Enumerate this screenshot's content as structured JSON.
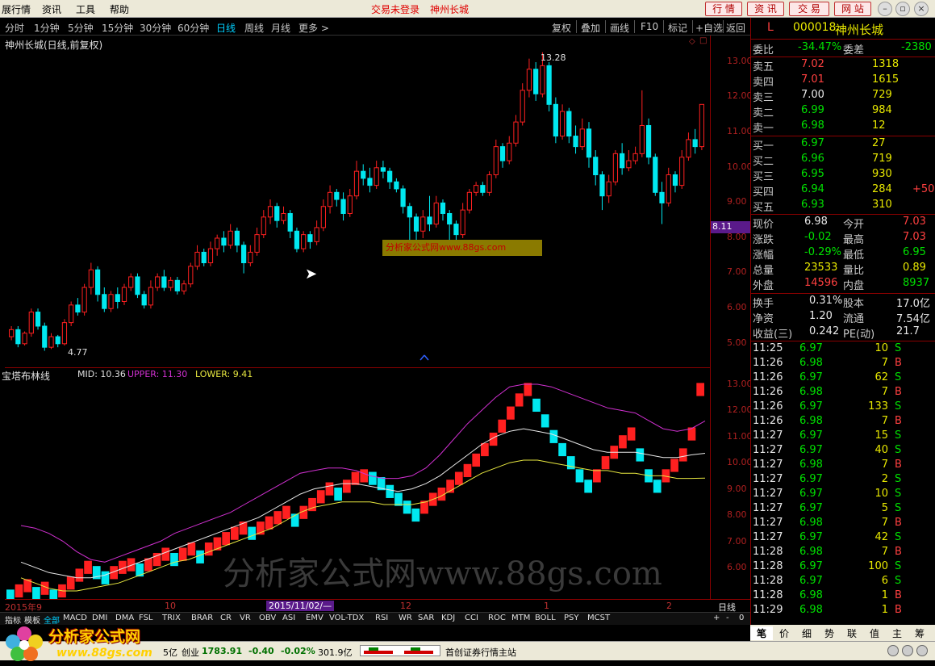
{
  "menu": {
    "items": [
      "展行情",
      "资讯",
      "工具",
      "帮助"
    ],
    "login_status": "交易未登录",
    "stock_title": "神州长城",
    "buttons": [
      "行 情",
      "资 讯",
      "交 易",
      "网 站"
    ]
  },
  "period": {
    "items": [
      "分时",
      "1分钟",
      "5分钟",
      "15分钟",
      "30分钟",
      "60分钟",
      "日线",
      "周线",
      "月线",
      "更多 >"
    ],
    "active": "日线"
  },
  "toolbar": {
    "items": [
      "复权",
      "叠加",
      "画线",
      "F10",
      "标记",
      "+自选",
      "返回"
    ]
  },
  "main_chart": {
    "title": "神州长城(日线,前复权)",
    "max_label": "13.28",
    "min_label": "4.77",
    "watermark": "分析家公式网www.88gs.com",
    "price_tag": "8.11"
  },
  "sub_chart": {
    "title": "宝塔布林线",
    "mid": "MID: 10.36",
    "upper": "UPPER: 11.30",
    "lower": "LOWER: 9.41",
    "watermark": "分析家公式网www.88gs.com"
  },
  "axis1": [
    "13.00",
    "12.00",
    "11.00",
    "10.00",
    "9.00",
    "8.00",
    "7.00",
    "6.00",
    "5.00"
  ],
  "axis2": [
    "13.00",
    "12.00",
    "11.00",
    "10.00",
    "9.00",
    "8.00",
    "7.00",
    "6.00"
  ],
  "dates": {
    "start": "2015年9",
    "m10": "10",
    "cursor": "2015/11/02/—",
    "m12": "12",
    "m1": "1",
    "m2": "2",
    "period": "日线"
  },
  "indicator_tabs": [
    "指标",
    "模板",
    "全部",
    "MACD",
    "DMI",
    "DMA",
    "FSL",
    "TRIX",
    "BRAR",
    "CR",
    "VR",
    "OBV",
    "ASI",
    "EMV",
    "VOL-TDX",
    "RSI",
    "WR",
    "SAR",
    "KDJ",
    "CCI",
    "ROC",
    "MTM",
    "BOLL",
    "PSY",
    "MCST"
  ],
  "quote": {
    "code": "000018",
    "name": "神州长城",
    "flag": "L",
    "weibi_label": "委比",
    "weibi": "-34.47%",
    "weicha_label": "委差",
    "weicha": "-2380",
    "asks": [
      {
        "l": "卖五",
        "p": "7.02",
        "v": "1318"
      },
      {
        "l": "卖四",
        "p": "7.01",
        "v": "1615"
      },
      {
        "l": "卖三",
        "p": "7.00",
        "v": "729"
      },
      {
        "l": "卖二",
        "p": "6.99",
        "v": "984"
      },
      {
        "l": "卖一",
        "p": "6.98",
        "v": "12"
      }
    ],
    "bids": [
      {
        "l": "买一",
        "p": "6.97",
        "v": "27"
      },
      {
        "l": "买二",
        "p": "6.96",
        "v": "719"
      },
      {
        "l": "买三",
        "p": "6.95",
        "v": "930"
      },
      {
        "l": "买四",
        "p": "6.94",
        "v": "284",
        "x": "+50"
      },
      {
        "l": "买五",
        "p": "6.93",
        "v": "310"
      }
    ],
    "stats": [
      {
        "l1": "现价",
        "v1": "6.98",
        "l2": "今开",
        "v2": "7.03"
      },
      {
        "l1": "涨跌",
        "v1": "-0.02",
        "l2": "最高",
        "v2": "7.03"
      },
      {
        "l1": "涨幅",
        "v1": "-0.29%",
        "l2": "最低",
        "v2": "6.95"
      },
      {
        "l1": "总量",
        "v1": "23533",
        "l2": "量比",
        "v2": "0.89"
      },
      {
        "l1": "外盘",
        "v1": "14596",
        "l2": "内盘",
        "v2": "8937"
      }
    ],
    "fund": [
      {
        "l1": "换手",
        "v1": "0.31%",
        "l2": "股本",
        "v2": "17.0亿"
      },
      {
        "l1": "净资",
        "v1": "1.20",
        "l2": "流通",
        "v2": "7.54亿"
      },
      {
        "l1": "收益(三)",
        "v1": "0.242",
        "l2": "PE(动)",
        "v2": "21.7"
      }
    ]
  },
  "ticks": [
    [
      "11:25",
      "6.97",
      "10",
      "S"
    ],
    [
      "11:26",
      "6.98",
      "7",
      "B"
    ],
    [
      "11:26",
      "6.97",
      "62",
      "S"
    ],
    [
      "11:26",
      "6.98",
      "7",
      "B"
    ],
    [
      "11:26",
      "6.97",
      "133",
      "S"
    ],
    [
      "11:26",
      "6.98",
      "7",
      "B"
    ],
    [
      "11:27",
      "6.97",
      "15",
      "S"
    ],
    [
      "11:27",
      "6.97",
      "40",
      "S"
    ],
    [
      "11:27",
      "6.98",
      "7",
      "B"
    ],
    [
      "11:27",
      "6.97",
      "2",
      "S"
    ],
    [
      "11:27",
      "6.97",
      "10",
      "S"
    ],
    [
      "11:27",
      "6.97",
      "5",
      "S"
    ],
    [
      "11:27",
      "6.98",
      "7",
      "B"
    ],
    [
      "11:27",
      "6.97",
      "42",
      "S"
    ],
    [
      "11:28",
      "6.98",
      "7",
      "B"
    ],
    [
      "11:28",
      "6.97",
      "100",
      "S"
    ],
    [
      "11:28",
      "6.97",
      "6",
      "S"
    ],
    [
      "11:28",
      "6.98",
      "1",
      "B"
    ],
    [
      "11:29",
      "6.98",
      "1",
      "B"
    ]
  ],
  "right_tabs": [
    "笔",
    "价",
    "细",
    "势",
    "联",
    "值",
    "主",
    "筹"
  ],
  "status": {
    "left": "5亿",
    "cy_label": "创业",
    "cy_val": "1783.91",
    "cy_chg": "-0.40",
    "cy_pct": "-0.02%",
    "cy_amt": "301.9亿",
    "broker": "首创证券行情主站"
  },
  "logo": {
    "brand": "分析家公式网",
    "url": "www.88gs.com"
  },
  "candles": [
    [
      5.2,
      5.4,
      5.1,
      5.5
    ],
    [
      5.4,
      5.0,
      4.9,
      5.5
    ],
    [
      5.0,
      5.3,
      4.95,
      5.35
    ],
    [
      5.3,
      5.9,
      5.2,
      6.0
    ],
    [
      5.9,
      5.5,
      5.4,
      6.0
    ],
    [
      5.5,
      4.9,
      4.8,
      5.6
    ],
    [
      4.9,
      5.2,
      4.85,
      5.3
    ],
    [
      5.2,
      5.0,
      4.9,
      5.25
    ],
    [
      5.0,
      5.6,
      4.95,
      5.7
    ],
    [
      5.6,
      6.1,
      5.5,
      6.2
    ],
    [
      6.1,
      5.9,
      5.8,
      6.3
    ],
    [
      5.9,
      6.6,
      5.8,
      6.7
    ],
    [
      6.6,
      7.1,
      6.4,
      7.3
    ],
    [
      7.1,
      6.4,
      6.2,
      7.2
    ],
    [
      6.4,
      6.0,
      5.9,
      6.6
    ],
    [
      6.0,
      6.4,
      5.9,
      6.5
    ],
    [
      6.4,
      6.2,
      6.0,
      6.6
    ],
    [
      6.2,
      6.6,
      6.1,
      6.7
    ],
    [
      6.6,
      6.9,
      6.5,
      7.0
    ],
    [
      6.9,
      6.4,
      6.3,
      7.0
    ],
    [
      6.4,
      6.1,
      6.0,
      6.5
    ],
    [
      6.1,
      6.6,
      6.0,
      6.8
    ],
    [
      6.6,
      6.9,
      6.5,
      7.0
    ],
    [
      6.9,
      6.6,
      6.5,
      7.1
    ],
    [
      6.6,
      6.8,
      6.5,
      6.9
    ],
    [
      6.8,
      6.5,
      6.4,
      6.9
    ],
    [
      6.5,
      6.7,
      6.4,
      6.8
    ],
    [
      6.7,
      7.2,
      6.6,
      7.3
    ],
    [
      7.2,
      7.6,
      7.1,
      7.8
    ],
    [
      7.6,
      7.3,
      7.2,
      7.7
    ],
    [
      7.3,
      7.7,
      7.2,
      7.9
    ],
    [
      7.7,
      8.0,
      7.5,
      8.1
    ],
    [
      8.0,
      7.8,
      7.6,
      8.2
    ],
    [
      7.8,
      8.2,
      7.7,
      8.4
    ],
    [
      8.2,
      7.8,
      7.6,
      8.3
    ],
    [
      7.8,
      7.3,
      7.0,
      7.9
    ],
    [
      7.3,
      7.6,
      7.2,
      7.8
    ],
    [
      7.6,
      8.1,
      7.5,
      8.3
    ],
    [
      8.1,
      8.6,
      8.0,
      8.8
    ],
    [
      8.6,
      8.9,
      8.4,
      9.1
    ],
    [
      8.9,
      8.5,
      8.3,
      9.0
    ],
    [
      8.5,
      8.7,
      8.4,
      8.9
    ],
    [
      8.7,
      8.2,
      8.0,
      8.8
    ],
    [
      8.2,
      7.7,
      7.6,
      8.3
    ],
    [
      7.7,
      8.1,
      7.6,
      8.2
    ],
    [
      8.1,
      7.9,
      7.7,
      8.2
    ],
    [
      7.9,
      8.3,
      7.8,
      8.5
    ],
    [
      8.3,
      8.9,
      8.2,
      9.1
    ],
    [
      8.9,
      9.3,
      8.7,
      9.5
    ],
    [
      9.3,
      9.1,
      8.9,
      9.4
    ],
    [
      9.1,
      8.7,
      8.5,
      9.3
    ],
    [
      8.7,
      9.2,
      8.6,
      9.4
    ],
    [
      9.2,
      9.9,
      9.1,
      10.2
    ],
    [
      9.9,
      9.7,
      9.5,
      10.1
    ],
    [
      9.7,
      9.5,
      9.3,
      10.0
    ],
    [
      9.5,
      10.0,
      9.4,
      10.2
    ],
    [
      10.0,
      9.9,
      9.7,
      10.2
    ],
    [
      9.9,
      9.6,
      9.4,
      10.0
    ],
    [
      9.6,
      9.4,
      9.3,
      9.7
    ],
    [
      9.4,
      8.9,
      8.7,
      9.5
    ],
    [
      8.9,
      8.6,
      7.9,
      9.0
    ],
    [
      8.6,
      8.2,
      7.8,
      8.7
    ],
    [
      8.2,
      8.6,
      8.0,
      8.8
    ],
    [
      8.6,
      8.4,
      8.2,
      9.2
    ],
    [
      8.4,
      9.0,
      8.3,
      9.2
    ],
    [
      9.0,
      8.7,
      8.5,
      9.1
    ],
    [
      8.7,
      8.4,
      7.9,
      8.8
    ],
    [
      8.4,
      8.1,
      7.8,
      8.5
    ],
    [
      8.1,
      8.8,
      8.0,
      9.0
    ],
    [
      8.8,
      9.3,
      8.7,
      9.4
    ],
    [
      9.3,
      9.5,
      9.2,
      9.6
    ],
    [
      9.5,
      9.3,
      9.2,
      9.6
    ],
    [
      9.3,
      9.8,
      9.2,
      9.9
    ],
    [
      9.8,
      10.6,
      9.7,
      10.8
    ],
    [
      10.6,
      10.2,
      10.0,
      10.7
    ],
    [
      10.2,
      10.7,
      10.1,
      10.9
    ],
    [
      10.7,
      11.3,
      10.6,
      11.5
    ],
    [
      11.3,
      12.2,
      11.2,
      12.4
    ],
    [
      12.2,
      12.8,
      12.0,
      13.1
    ],
    [
      12.8,
      12.1,
      11.9,
      13.0
    ],
    [
      12.1,
      12.9,
      12.0,
      13.28
    ],
    [
      12.9,
      11.8,
      11.6,
      13.0
    ],
    [
      11.8,
      10.9,
      10.7,
      12.0
    ],
    [
      10.9,
      11.6,
      10.8,
      11.8
    ],
    [
      11.6,
      10.9,
      10.7,
      11.7
    ],
    [
      10.9,
      10.6,
      10.4,
      11.2
    ],
    [
      10.6,
      11.1,
      10.5,
      11.4
    ],
    [
      11.1,
      10.3,
      10.0,
      11.3
    ],
    [
      10.3,
      9.8,
      9.5,
      10.5
    ],
    [
      9.8,
      9.2,
      8.8,
      9.9
    ],
    [
      9.2,
      9.6,
      9.0,
      9.8
    ],
    [
      9.6,
      10.4,
      9.5,
      10.5
    ],
    [
      10.4,
      10.0,
      9.8,
      10.7
    ],
    [
      10.0,
      10.2,
      9.9,
      10.5
    ],
    [
      10.2,
      10.4,
      10.1,
      10.6
    ],
    [
      10.4,
      11.2,
      10.3,
      12.2
    ],
    [
      11.2,
      10.3,
      10.1,
      11.4
    ],
    [
      10.3,
      9.3,
      9.2,
      10.4
    ],
    [
      9.3,
      9.0,
      8.4,
      9.6
    ],
    [
      9.0,
      9.8,
      8.9,
      10.0
    ],
    [
      9.8,
      9.5,
      9.3,
      9.9
    ],
    [
      9.5,
      10.3,
      9.4,
      10.5
    ],
    [
      10.3,
      10.8,
      10.2,
      11.0
    ],
    [
      10.8,
      10.6,
      10.4,
      11.1
    ],
    [
      10.6,
      11.8,
      10.5,
      11.8
    ]
  ],
  "baota": [
    [
      5.0,
      4.8
    ],
    [
      5.2,
      5.0
    ],
    [
      5.4,
      5.2
    ],
    [
      5.1,
      4.9
    ],
    [
      5.3,
      5.1
    ],
    [
      5.0,
      4.8
    ],
    [
      5.2,
      5.0
    ],
    [
      5.5,
      5.3
    ],
    [
      5.8,
      5.6
    ],
    [
      6.1,
      5.9
    ],
    [
      5.9,
      5.7
    ],
    [
      5.7,
      5.5
    ],
    [
      5.9,
      5.7
    ],
    [
      6.1,
      5.9
    ],
    [
      6.2,
      6.0
    ],
    [
      6.0,
      5.8
    ],
    [
      6.2,
      6.0
    ],
    [
      6.4,
      6.2
    ],
    [
      6.6,
      6.4
    ],
    [
      6.4,
      6.2
    ],
    [
      6.6,
      6.4
    ],
    [
      6.8,
      6.6
    ],
    [
      6.5,
      6.3
    ],
    [
      6.8,
      6.6
    ],
    [
      7.0,
      6.8
    ],
    [
      7.2,
      7.0
    ],
    [
      7.4,
      7.2
    ],
    [
      7.6,
      7.4
    ],
    [
      7.4,
      7.2
    ],
    [
      7.6,
      7.4
    ],
    [
      7.8,
      7.6
    ],
    [
      8.0,
      7.8
    ],
    [
      8.2,
      8.0
    ],
    [
      7.9,
      7.7
    ],
    [
      8.2,
      8.0
    ],
    [
      8.5,
      8.3
    ],
    [
      8.8,
      8.6
    ],
    [
      9.1,
      8.9
    ],
    [
      8.9,
      8.7
    ],
    [
      9.2,
      9.0
    ],
    [
      9.5,
      9.3
    ],
    [
      9.6,
      9.4
    ],
    [
      9.5,
      9.3
    ],
    [
      9.3,
      9.1
    ],
    [
      9.0,
      8.8
    ],
    [
      8.7,
      8.5
    ],
    [
      8.4,
      8.2
    ],
    [
      8.1,
      7.9
    ],
    [
      8.4,
      8.2
    ],
    [
      8.7,
      8.5
    ],
    [
      8.9,
      8.7
    ],
    [
      9.2,
      9.0
    ],
    [
      9.5,
      9.3
    ],
    [
      9.8,
      9.6
    ],
    [
      10.2,
      10.0
    ],
    [
      10.6,
      10.4
    ],
    [
      11.0,
      10.8
    ],
    [
      11.5,
      11.3
    ],
    [
      12.0,
      11.8
    ],
    [
      12.5,
      12.3
    ],
    [
      12.9,
      12.7
    ],
    [
      12.3,
      12.1
    ],
    [
      11.7,
      11.5
    ],
    [
      11.1,
      10.9
    ],
    [
      10.6,
      10.4
    ],
    [
      10.1,
      9.9
    ],
    [
      9.6,
      9.4
    ],
    [
      9.2,
      9.0
    ],
    [
      9.6,
      9.4
    ],
    [
      10.1,
      9.9
    ],
    [
      10.5,
      10.3
    ],
    [
      10.9,
      10.7
    ],
    [
      11.2,
      11.0
    ],
    [
      10.4,
      10.2
    ],
    [
      9.6,
      9.4
    ],
    [
      9.2,
      9.0
    ],
    [
      9.6,
      9.4
    ],
    [
      10.0,
      9.8
    ],
    [
      10.4,
      10.2
    ],
    [
      11.2,
      11.0
    ],
    [
      12.9,
      12.7
    ]
  ],
  "boll": {
    "upper": [
      7.6,
      7.5,
      7.3,
      7.0,
      6.6,
      6.3,
      6.2,
      6.4,
      6.6,
      6.8,
      7.0,
      7.3,
      7.5,
      7.7,
      7.9,
      8.1,
      8.4,
      8.7,
      9.0,
      9.3,
      9.6,
      9.7,
      9.8,
      9.8,
      9.7,
      9.5,
      9.4,
      9.4,
      9.5,
      9.8,
      10.3,
      10.9,
      11.5,
      12.0,
      12.5,
      12.9,
      13.0,
      13.0,
      12.9,
      12.7,
      12.5,
      12.3,
      12.1,
      12.0,
      11.9,
      11.6,
      11.3,
      11.2,
      11.3,
      11.6
    ],
    "mid": [
      6.2,
      6.0,
      5.8,
      5.7,
      5.6,
      5.6,
      5.7,
      5.9,
      6.1,
      6.3,
      6.5,
      6.7,
      6.9,
      7.1,
      7.3,
      7.5,
      7.7,
      7.9,
      8.2,
      8.5,
      8.8,
      9.0,
      9.1,
      9.2,
      9.2,
      9.1,
      9.0,
      8.9,
      9.0,
      9.2,
      9.5,
      9.9,
      10.3,
      10.7,
      11.0,
      11.2,
      11.3,
      11.2,
      11.1,
      10.9,
      10.7,
      10.5,
      10.4,
      10.4,
      10.4,
      10.3,
      10.2,
      10.2,
      10.3,
      10.36
    ],
    "lower": [
      5.6,
      5.4,
      5.2,
      5.1,
      5.1,
      5.2,
      5.3,
      5.4,
      5.6,
      5.8,
      6.0,
      6.2,
      6.3,
      6.5,
      6.7,
      6.9,
      7.1,
      7.3,
      7.5,
      7.8,
      8.1,
      8.3,
      8.4,
      8.5,
      8.5,
      8.5,
      8.4,
      8.4,
      8.4,
      8.5,
      8.7,
      9.0,
      9.3,
      9.6,
      9.8,
      10.0,
      10.1,
      10.1,
      10.0,
      9.9,
      9.8,
      9.7,
      9.7,
      9.6,
      9.6,
      9.5,
      9.5,
      9.4,
      9.4,
      9.41
    ]
  },
  "colors": {
    "up": "#ff2020",
    "down": "#00e8f0",
    "upper": "#d030d0",
    "mid": "#e8e8e8",
    "lower": "#e8e840"
  }
}
